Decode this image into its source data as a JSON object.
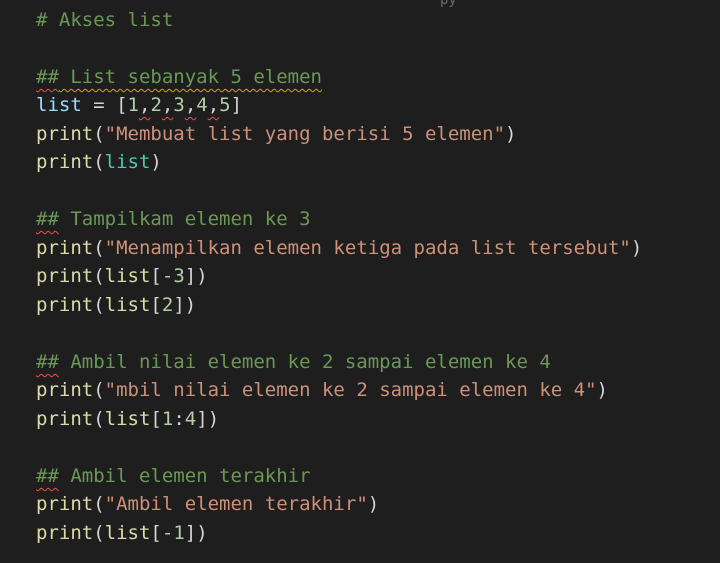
{
  "editor": {
    "top_fragment": "py",
    "lines": [
      {
        "text": "# Akses list"
      },
      {
        "text": ""
      },
      {
        "hash": "##",
        "text": " List sebanyak 5 elemen"
      },
      {
        "var": "list",
        "eq": " = ",
        "open": "[",
        "n1": "1",
        "c1": ",",
        "n2": "2",
        "c2": ",",
        "n3": "3",
        "c3": ",",
        "n4": "4",
        "c4": ",",
        "n5": "5",
        "close": "]"
      },
      {
        "func": "print",
        "open": "(",
        "str": "\"Membuat list yang berisi 5 elemen\"",
        "close": ")"
      },
      {
        "func": "print",
        "open": "(",
        "arg": "list",
        "close": ")"
      },
      {
        "text": ""
      },
      {
        "hash": "##",
        "text": " Tampilkam elemen ke 3"
      },
      {
        "func": "print",
        "open": "(",
        "str": "\"Menampilkan elemen ketiga pada list tersebut\"",
        "close": ")"
      },
      {
        "func": "print",
        "open": "(",
        "arg": "list",
        "idx_open": "[",
        "num": "-3",
        "idx_close": "]",
        "close": ")"
      },
      {
        "func": "print",
        "open": "(",
        "arg": "list",
        "idx_open": "[",
        "num": "2",
        "idx_close": "]",
        "close": ")"
      },
      {
        "text": ""
      },
      {
        "hash": "##",
        "text": " Ambil nilai elemen ke 2 sampai elemen ke 4"
      },
      {
        "func": "print",
        "open": "(",
        "str": "\"mbil nilai elemen ke 2 sampai elemen ke 4\"",
        "close": ")"
      },
      {
        "func": "print",
        "open": "(",
        "arg": "list",
        "idx_open": "[",
        "num": "1",
        "colon": ":",
        "num2": "4",
        "idx_close": "]",
        "close": ")"
      },
      {
        "text": ""
      },
      {
        "hash": "##",
        "text": " Ambil elemen terakhir"
      },
      {
        "func": "print",
        "open": "(",
        "str": "\"Ambil elemen terakhir\"",
        "close": ")"
      },
      {
        "func": "print",
        "open": "(",
        "arg": "list",
        "idx_open": "[",
        "num": "-1",
        "idx_close": "]",
        "close": ")"
      }
    ]
  },
  "colors": {
    "background": "#1e1e1e",
    "comment": "#6a9955",
    "function": "#dcdcaa",
    "string": "#ce9178",
    "number": "#b5cea8",
    "variable": "#9cdcfe",
    "error_squiggle": "#f14c4c",
    "warning_squiggle": "#cca700"
  }
}
